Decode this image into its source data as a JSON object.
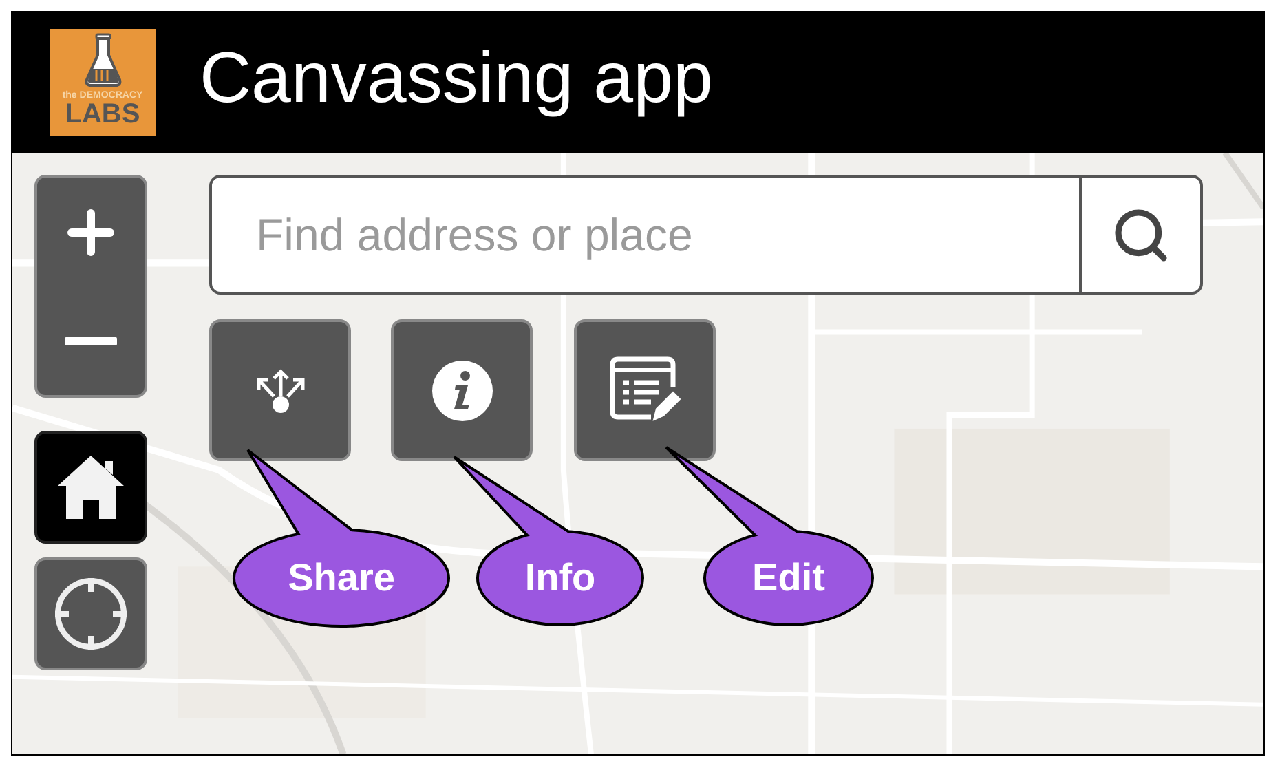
{
  "header": {
    "logo": {
      "small_text": "the DEMOCRACY",
      "big_text": "LABS"
    },
    "title": "Canvassing app"
  },
  "map_controls": [
    {
      "kind": "zoom",
      "selected": false
    },
    {
      "kind": "home",
      "selected": true
    },
    {
      "kind": "locate",
      "selected": false
    }
  ],
  "search": {
    "placeholder": "Find address or place"
  },
  "tools": [
    {
      "kind": "share",
      "callout": "Share",
      "color": "#9b57e0"
    },
    {
      "kind": "info",
      "callout": "Info",
      "color": "#9b57e0"
    },
    {
      "kind": "edit",
      "callout": "Edit",
      "color": "#9b57e0"
    }
  ]
}
